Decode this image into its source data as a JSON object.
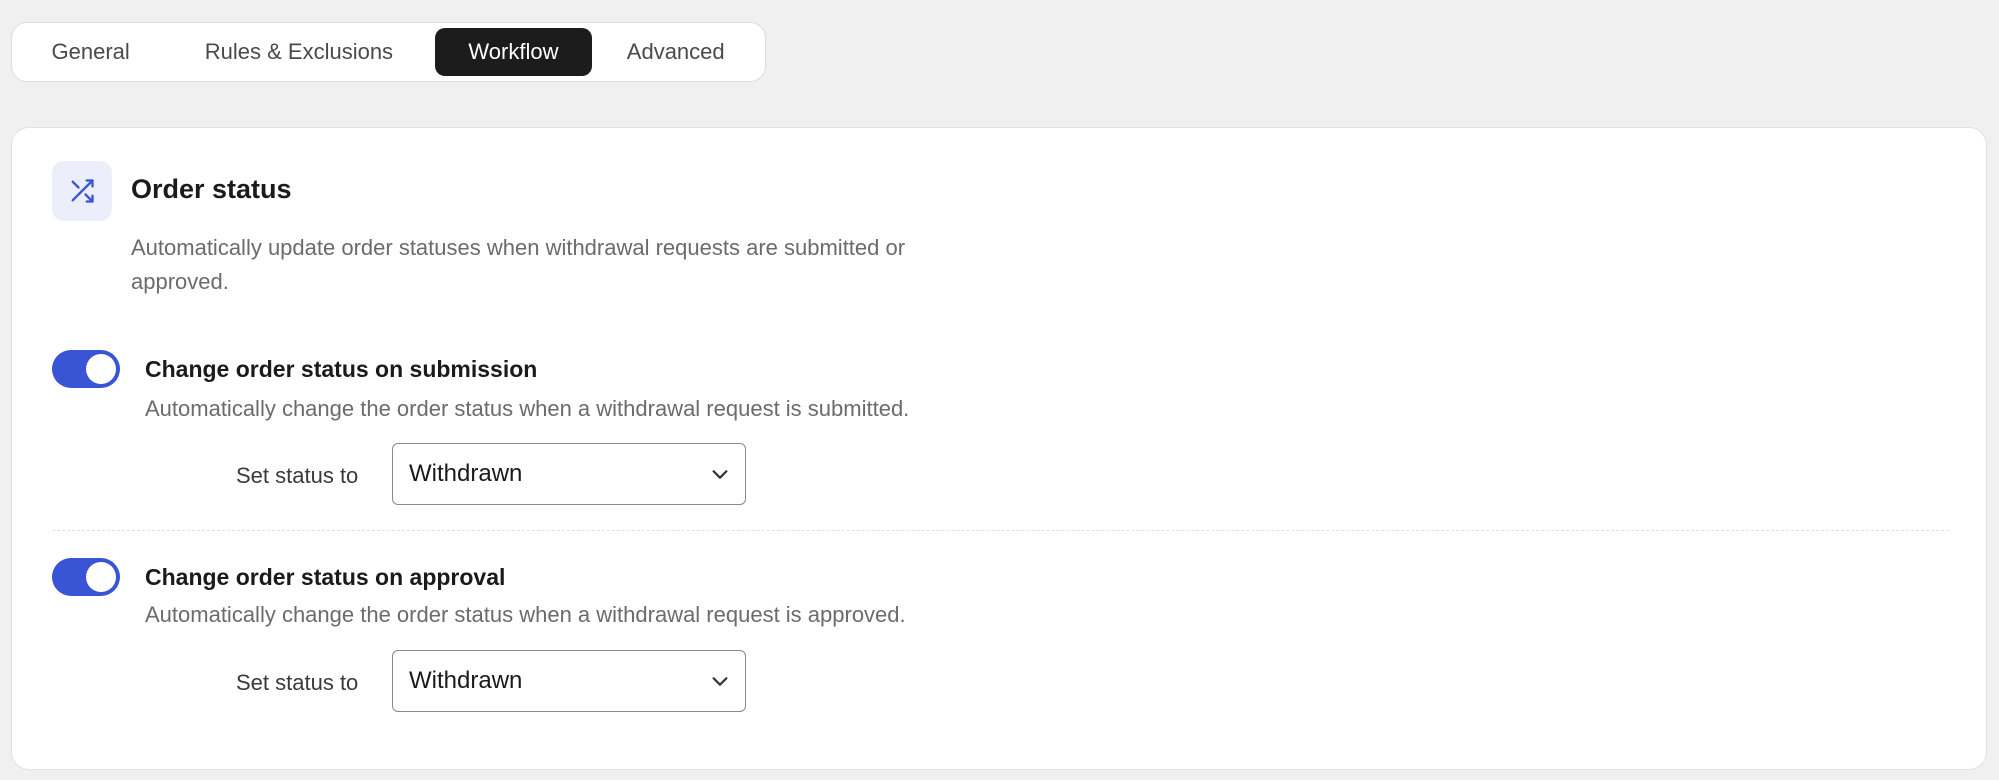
{
  "tabs": [
    {
      "label": "General",
      "active": false
    },
    {
      "label": "Rules & Exclusions",
      "active": false
    },
    {
      "label": "Workflow",
      "active": true
    },
    {
      "label": "Advanced",
      "active": false
    }
  ],
  "section": {
    "icon": "shuffle-icon",
    "title": "Order status",
    "description": "Automatically update order statuses when withdrawal requests are submitted or approved."
  },
  "options": [
    {
      "title": "Change order status on submission",
      "description": "Automatically change the order status when a withdrawal request is submitted.",
      "enabled": true,
      "field_label": "Set status to",
      "selected_status": "Withdrawn"
    },
    {
      "title": "Change order status on approval",
      "description": "Automatically change the order status when a withdrawal request is approved.",
      "enabled": true,
      "field_label": "Set status to",
      "selected_status": "Withdrawn"
    }
  ],
  "colors": {
    "accent": "#3a54d6",
    "active_tab": "#1c1c1c",
    "background": "#f0f0f0"
  }
}
